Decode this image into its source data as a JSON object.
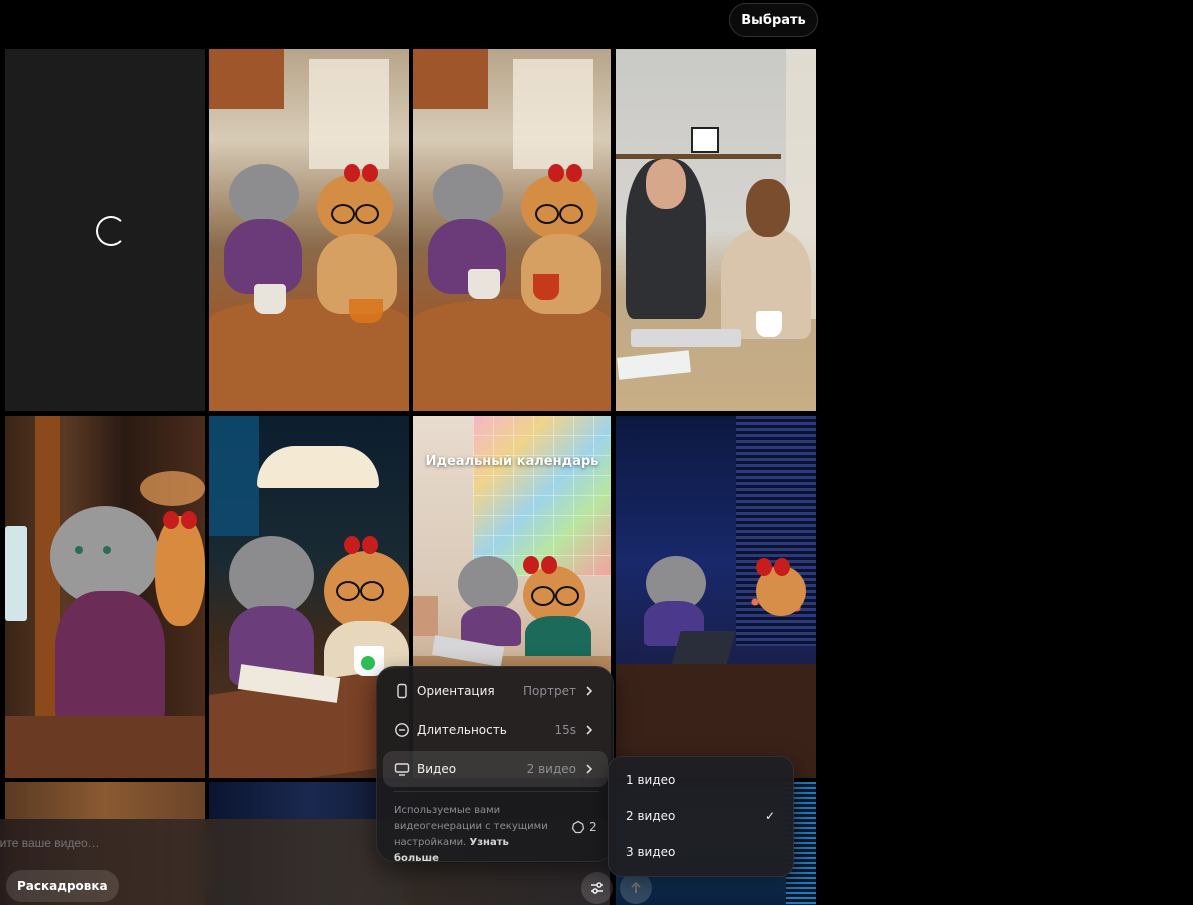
{
  "header": {
    "select_label": "Выбрать"
  },
  "grid": {
    "tile_caption": "Идеальный календарь"
  },
  "prompt": {
    "placeholder": "шите ваше видео…",
    "storyboard_label": "Раскадровка"
  },
  "settings_menu": {
    "items": [
      {
        "label": "Ориентация",
        "value": "Портрет",
        "icon": "phone-portrait-icon"
      },
      {
        "label": "Длительность",
        "value": "15s",
        "icon": "clock-icon"
      },
      {
        "label": "Видео",
        "value": "2 видео",
        "icon": "monitor-icon"
      }
    ],
    "note_text": "Используемые вами видеогенерации с текущими настройками.",
    "note_link": "Узнать больше",
    "credits": "2"
  },
  "video_count_menu": {
    "options": [
      "1 видео",
      "2 видео",
      "3 видео"
    ],
    "selected": "2 видео",
    "check": "✓"
  }
}
